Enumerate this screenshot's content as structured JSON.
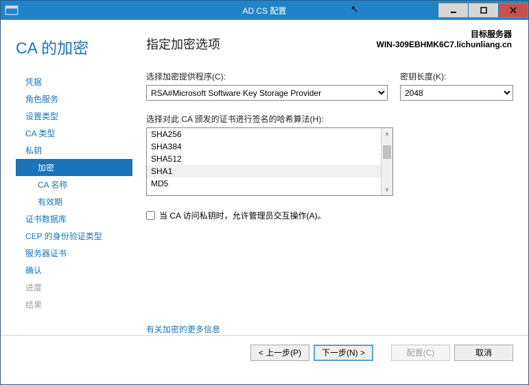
{
  "window": {
    "title": "AD CS 配置"
  },
  "top_right": {
    "l1": "目标服务器",
    "l2": "WIN-309EBHMK6C7.lichunliang.cn"
  },
  "page_title": "CA 的加密",
  "nav": {
    "items": [
      {
        "label": "凭据",
        "indent": false,
        "disabled": false,
        "active": false
      },
      {
        "label": "角色服务",
        "indent": false,
        "disabled": false,
        "active": false
      },
      {
        "label": "设置类型",
        "indent": false,
        "disabled": false,
        "active": false
      },
      {
        "label": "CA 类型",
        "indent": false,
        "disabled": false,
        "active": false
      },
      {
        "label": "私钥",
        "indent": false,
        "disabled": false,
        "active": false
      },
      {
        "label": "加密",
        "indent": true,
        "disabled": false,
        "active": true
      },
      {
        "label": "CA 名称",
        "indent": true,
        "disabled": false,
        "active": false
      },
      {
        "label": "有效期",
        "indent": true,
        "disabled": false,
        "active": false
      },
      {
        "label": "证书数据库",
        "indent": false,
        "disabled": false,
        "active": false
      },
      {
        "label": "CEP 的身份验证类型",
        "indent": false,
        "disabled": false,
        "active": false
      },
      {
        "label": "服务器证书",
        "indent": false,
        "disabled": false,
        "active": false
      },
      {
        "label": "确认",
        "indent": false,
        "disabled": false,
        "active": false
      },
      {
        "label": "进度",
        "indent": false,
        "disabled": true,
        "active": false
      },
      {
        "label": "结果",
        "indent": false,
        "disabled": true,
        "active": false
      }
    ]
  },
  "main": {
    "heading": "指定加密选项",
    "provider_label": "选择加密提供程序(C):",
    "provider_value": "RSA#Microsoft Software Key Storage Provider",
    "keylen_label": "密钥长度(K):",
    "keylen_value": "2048",
    "hash_label": "选择对此 CA 颁发的证书进行签名的哈希算法(H):",
    "hash_options": [
      "SHA256",
      "SHA384",
      "SHA512",
      "SHA1",
      "MD5"
    ],
    "hash_selected_index": 3,
    "checkbox_label": "当 CA 访问私钥时，允许管理员交互操作(A)。",
    "more_link": "有关加密的更多信息"
  },
  "footer": {
    "prev": "< 上一步(P)",
    "next": "下一步(N) >",
    "configure": "配置(C)",
    "cancel": "取消"
  }
}
